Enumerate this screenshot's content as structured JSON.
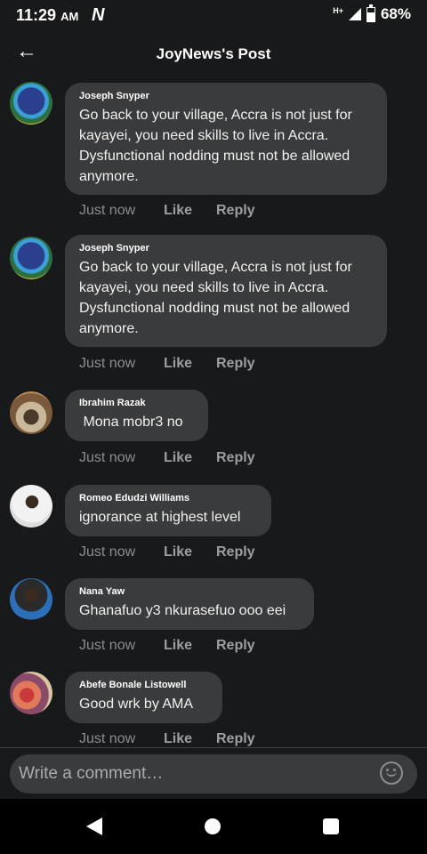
{
  "status_bar": {
    "time": "11:29",
    "ampm": "AM",
    "network_type": "H+",
    "battery": "68%",
    "icons": [
      "n-app-icon",
      "network-icon",
      "signal-icon",
      "battery-icon"
    ]
  },
  "header": {
    "title": "JoyNews's Post",
    "back_icon": "arrow-left-icon"
  },
  "comments": [
    {
      "author": "Joseph Snyper",
      "text": "Go back to your village, Accra is not just for kayayei, you need skills to live in Accra. Dysfunctional nodding must not be allowed anymore.",
      "time": "Just now",
      "like": "Like",
      "reply": "Reply"
    },
    {
      "author": "Joseph Snyper",
      "text": "Go back to your village, Accra is not just for kayayei, you need skills to live in Accra. Dysfunctional nodding must not be allowed anymore.",
      "time": "Just now",
      "like": "Like",
      "reply": "Reply"
    },
    {
      "author": "Ibrahim Razak",
      "text": " Mona mobr3 no",
      "time": "Just now",
      "like": "Like",
      "reply": "Reply"
    },
    {
      "author": "Romeo Edudzi Williams",
      "text": "ignorance at highest level",
      "time": "Just now",
      "like": "Like",
      "reply": "Reply"
    },
    {
      "author": "Nana Yaw",
      "text": "Ghanafuo y3 nkurasefuo ooo eei",
      "time": "Just now",
      "like": "Like",
      "reply": "Reply"
    },
    {
      "author": "Abefe Bonale Listowell",
      "text": "Good wrk by AMA",
      "time": "Just now",
      "like": "Like",
      "reply": "Reply"
    }
  ],
  "composer": {
    "placeholder": "Write a comment…",
    "emoji_icon": "emoji-icon"
  },
  "nav_bar": {
    "icons": [
      "back-triangle-icon",
      "home-circle-icon",
      "recents-square-icon"
    ]
  }
}
